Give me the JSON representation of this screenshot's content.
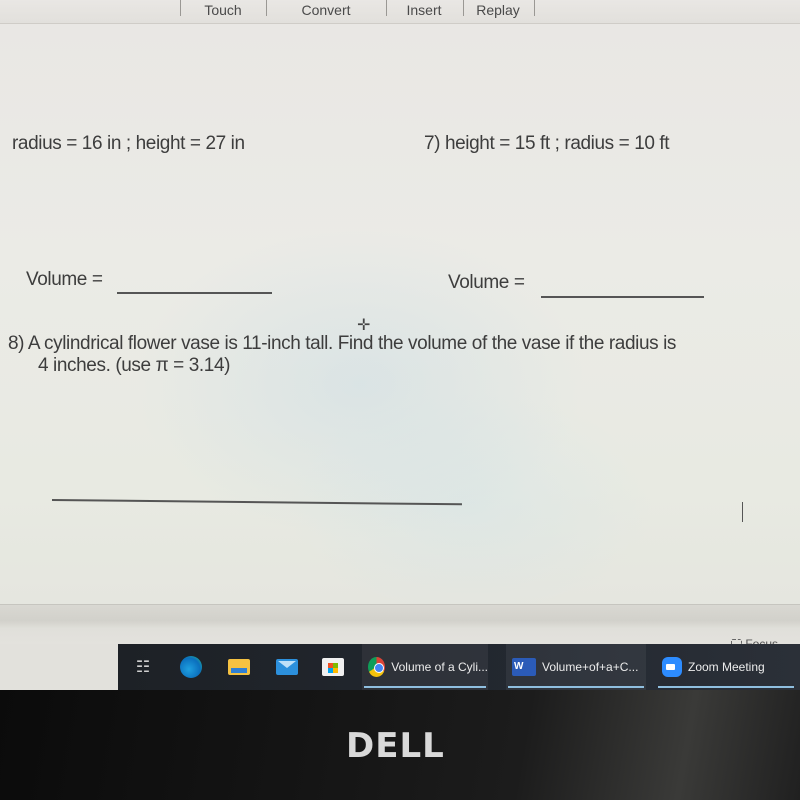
{
  "ribbon": {
    "tabs": [
      "Touch",
      "Convert",
      "Insert",
      "Replay"
    ]
  },
  "worksheet": {
    "problem6": {
      "text": "radius = 16 in ; height = 27 in",
      "answer_label": "Volume ="
    },
    "problem7": {
      "text": "7)  height = 15 ft ; radius = 10 ft",
      "answer_label": "Volume ="
    },
    "problem8": {
      "line1": "8)  A cylindrical flower vase is 11-inch tall. Find the volume of the vase if the radius is",
      "line2": "4 inches. (use π = 3.14)"
    },
    "cursor_glyph": "✛"
  },
  "statusbar": {
    "focus_label": "Focus"
  },
  "taskbar": {
    "apps": [
      {
        "icon": "chrome-icon",
        "label": "Volume of a Cyli..."
      },
      {
        "icon": "word-icon",
        "icon_text": "W",
        "label": "Volume+of+a+C..."
      },
      {
        "icon": "zoom-icon",
        "label": "Zoom Meeting"
      }
    ],
    "task_view_glyph": "☷"
  },
  "bezel": {
    "brand": "DELL"
  },
  "colors": {
    "text": "#3d3d3d",
    "taskbar": "#1d2126",
    "underline": "#8fbfe0"
  }
}
